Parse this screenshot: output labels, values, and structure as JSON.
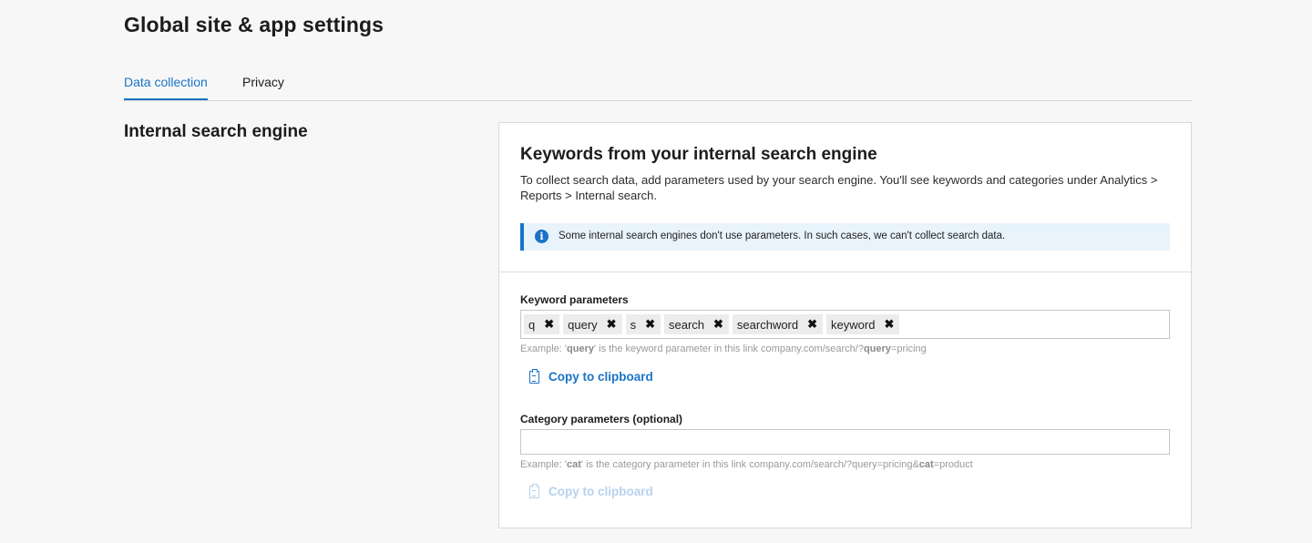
{
  "page": {
    "title": "Global site & app settings"
  },
  "tabs": [
    {
      "label": "Data collection",
      "active": true
    },
    {
      "label": "Privacy",
      "active": false
    }
  ],
  "section": {
    "title": "Internal search engine"
  },
  "card": {
    "title": "Keywords from your internal search engine",
    "description": "To collect search data, add parameters used by your search engine. You'll see keywords and categories under Analytics > Reports > Internal search.",
    "info": {
      "icon": "info-icon",
      "text": "Some internal search engines don't use parameters. In such cases, we can't collect search data."
    }
  },
  "keyword_params": {
    "label": "Keyword parameters",
    "tags": [
      "q",
      "query",
      "s",
      "search",
      "searchword",
      "keyword"
    ],
    "remove_glyph": "✖",
    "hint": {
      "prefix": "Example: '",
      "param": "query",
      "middle": "' is the keyword parameter in this link company.com/search/?",
      "param2": "query",
      "suffix": "=pricing"
    },
    "copy_label": "Copy to clipboard"
  },
  "category_params": {
    "label": "Category parameters (optional)",
    "value": "",
    "placeholder": "",
    "hint": {
      "prefix": "Example: '",
      "param": "cat",
      "middle": "' is the category parameter in this link company.com/search/?query=pricing&",
      "param2": "cat",
      "suffix": "=product"
    },
    "copy_label": "Copy to clipboard",
    "copy_disabled": true
  },
  "colors": {
    "accent": "#1a73c7",
    "info_bg": "#e8f3fc",
    "disabled_link": "#b6d2ee",
    "page_bg": "#f7f7f7"
  }
}
